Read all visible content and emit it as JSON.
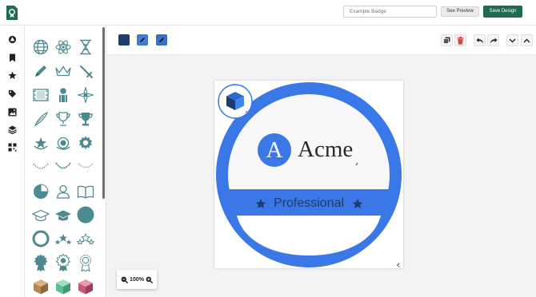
{
  "header": {
    "badge_name_placeholder": "Example Badge",
    "preview_label": "See Preview",
    "save_label": "Save Design"
  },
  "sidebar": {
    "items": [
      {
        "icon": "shapes-icon"
      },
      {
        "icon": "bookmark-icon"
      },
      {
        "icon": "star-icon"
      },
      {
        "icon": "tag-icon"
      },
      {
        "icon": "image-icon"
      },
      {
        "icon": "layers-icon"
      },
      {
        "icon": "qr-code-icon"
      }
    ]
  },
  "toolbar": {
    "colors": [
      "#1c3e6e",
      "#3f7bd4",
      "#3a6fc8"
    ]
  },
  "badge": {
    "brand_letter": "A",
    "brand_name": "Acme",
    "banner_text": "Professional",
    "primary_color": "#3b78e7",
    "navy_color": "#1e3c6c"
  },
  "zoom": {
    "level": "100%"
  }
}
